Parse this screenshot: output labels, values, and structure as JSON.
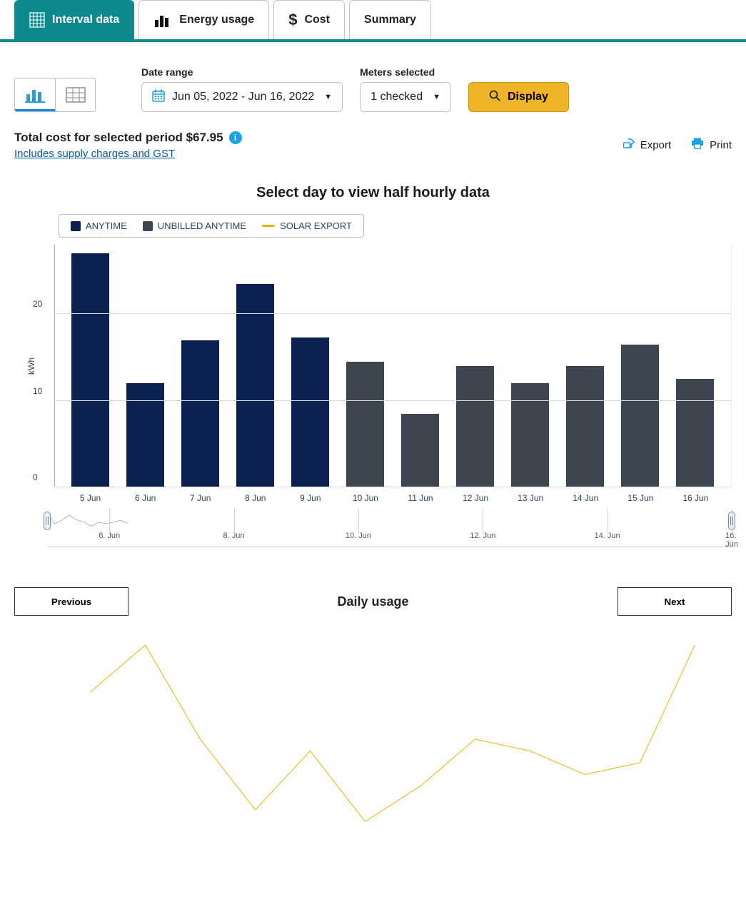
{
  "tabs": {
    "interval_data": "Interval data",
    "energy_usage": "Energy usage",
    "cost": "Cost",
    "summary": "Summary"
  },
  "controls": {
    "date_range_label": "Date range",
    "date_range_value": "Jun 05, 2022 - Jun 16, 2022",
    "meters_label": "Meters selected",
    "meters_value": "1 checked",
    "display_btn": "Display"
  },
  "summary": {
    "total_cost_label": "Total cost for selected period $67.95",
    "supply_link": "Includes supply charges and GST",
    "export": "Export",
    "print": "Print"
  },
  "chart_title": "Select day to view half hourly data",
  "legend": {
    "anytime": "ANYTIME",
    "unbilled": "UNBILLED ANYTIME",
    "solar": "SOLAR EXPORT"
  },
  "y_label": "kWh",
  "y_ticks": [
    "0",
    "10",
    "20"
  ],
  "chart_data": {
    "type": "bar",
    "title": "Select day to view half hourly data",
    "xlabel": "",
    "ylabel": "kWh",
    "ylim": [
      0,
      28
    ],
    "categories": [
      "5 Jun",
      "6 Jun",
      "7 Jun",
      "8 Jun",
      "9 Jun",
      "10 Jun",
      "11 Jun",
      "12 Jun",
      "13 Jun",
      "14 Jun",
      "15 Jun",
      "16 Jun"
    ],
    "series": [
      {
        "name": "ANYTIME",
        "color": "#0d2150",
        "values": [
          27,
          12,
          17,
          23.5,
          17.3,
          null,
          null,
          null,
          null,
          null,
          null,
          null
        ]
      },
      {
        "name": "UNBILLED ANYTIME",
        "color": "#3c4550",
        "values": [
          null,
          null,
          null,
          null,
          null,
          14.5,
          8.5,
          14,
          12,
          14,
          16.5,
          12.5
        ]
      },
      {
        "name": "SOLAR EXPORT",
        "color": "#e8b400",
        "type": "line",
        "values": [
          9,
          11,
          7,
          4,
          6.5,
          3.5,
          5,
          7,
          6.5,
          5.5,
          6,
          11
        ]
      }
    ]
  },
  "navigator_ticks": [
    "6. Jun",
    "8. Jun",
    "10. Jun",
    "12. Jun",
    "14. Jun",
    "16. Jun"
  ],
  "pager": {
    "prev": "Previous",
    "title": "Daily usage",
    "next": "Next"
  }
}
